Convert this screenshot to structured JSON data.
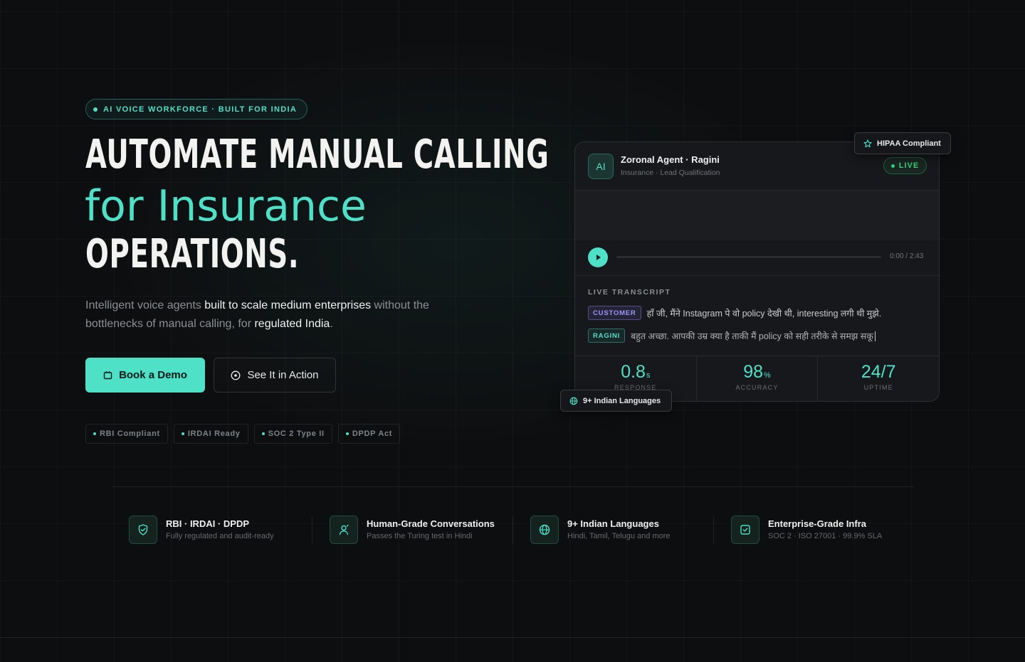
{
  "eyebrow": "AI VOICE WORKFORCE · BUILT FOR INDIA",
  "headline": {
    "line1": "AUTOMATE MANUAL CALLING",
    "line2": "for Insurance",
    "line3": "OPERATIONS."
  },
  "lede": {
    "p1": "Intelligent voice agents ",
    "b1": "built to scale medium enterprises",
    "p2": " without the bottlenecks of manual calling, for ",
    "b2": "regulated India",
    "p3": "."
  },
  "buttons": {
    "primary": "Book a Demo",
    "secondary": "See It in Action"
  },
  "compliance_chips": [
    "RBI Compliant",
    "IRDAI Ready",
    "SOC 2 Type II",
    "DPDP Act"
  ],
  "agent_card": {
    "avatar": "AI",
    "name": "Zoronal Agent · Ragini",
    "subtitle": "Insurance · Lead Qualification",
    "status": "LIVE",
    "player": {
      "time": "0:00 / 2:43",
      "progress": 0
    },
    "transcript_label": "LIVE TRANSCRIPT",
    "transcript": [
      {
        "speaker": "CUSTOMER",
        "text": "हाँ जी, मैंने Instagram पे वो policy देखी थी, interesting लगी थी मुझे."
      },
      {
        "speaker": "RAGINI",
        "text": "बहुत अच्छा. आपकी उम्र क्या है ताकी मैं policy को सही तरीके से समझ सकू"
      }
    ],
    "stats": [
      {
        "value": "0.8",
        "unit": "s",
        "label": "RESPONSE"
      },
      {
        "value": "98",
        "unit": "%",
        "label": "ACCURACY"
      },
      {
        "value": "24/7",
        "unit": "",
        "label": "UPTIME"
      }
    ]
  },
  "floating_badges": {
    "hipaa": "HIPAA Compliant",
    "languages": "9+ Indian Languages"
  },
  "features": [
    {
      "icon": "shield-check-icon",
      "title": "RBI · IRDAI · DPDP",
      "subtitle": "Fully regulated and audit-ready"
    },
    {
      "icon": "user-icon",
      "title": "Human-Grade Conversations",
      "subtitle": "Passes the Turing test in Hindi"
    },
    {
      "icon": "globe-icon",
      "title": "9+ Indian Languages",
      "subtitle": "Hindi, Tamil, Telugu and more"
    },
    {
      "icon": "checkbox-icon",
      "title": "Enterprise-Grade Infra",
      "subtitle": "SOC 2 · ISO 27001 · 99.9% SLA"
    }
  ],
  "colors": {
    "accent": "#4fe0c8",
    "background": "#0d0e10",
    "live_green": "#34d17a",
    "customer_tag": "#9d96ff"
  }
}
